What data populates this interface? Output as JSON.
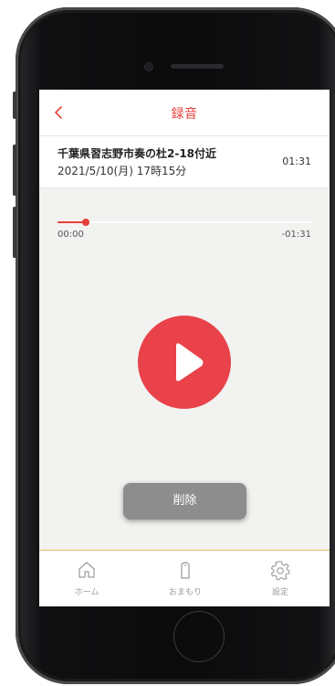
{
  "nav": {
    "title": "録音",
    "back_icon": "chevron-left-icon"
  },
  "recording": {
    "location": "千葉県習志野市奏の杜2-18付近",
    "datetime": "2021/5/10(月) 17時15分",
    "duration": "01:31"
  },
  "player": {
    "elapsed": "00:00",
    "remaining": "-01:31",
    "progress_fraction": 0.11,
    "play_icon": "play-icon"
  },
  "delete_label": "削除",
  "tabs": [
    {
      "label": "ホーム",
      "icon": "home-icon"
    },
    {
      "label": "おまもり",
      "icon": "omamori-icon"
    },
    {
      "label": "設定",
      "icon": "gear-icon"
    }
  ],
  "colors": {
    "accent": "#e5413c",
    "play": "#e9424a",
    "delete": "#8d8d8d",
    "tab_border": "#f0b86a"
  }
}
